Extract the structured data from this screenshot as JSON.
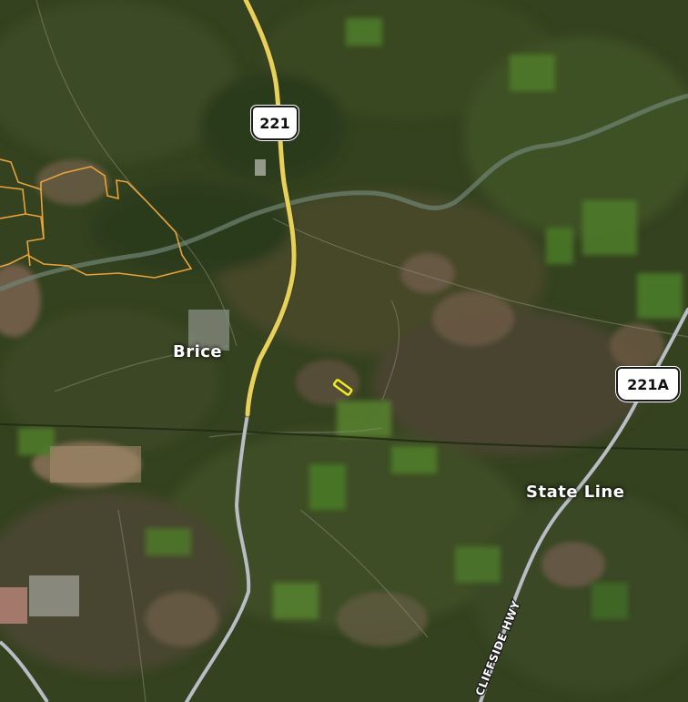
{
  "map": {
    "type": "satellite",
    "colors": {
      "highway_primary": "#e7d15a",
      "highway_secondary": "#b8bcc4",
      "parcel_outline": "#e8a33a",
      "highlight_marker": "#f2ef1e",
      "label_text": "#ffffff",
      "state_boundary": "#1e2a14"
    },
    "places": [
      {
        "id": "brice",
        "label": "Brice"
      },
      {
        "id": "state-line",
        "label": "State Line"
      }
    ],
    "shields": [
      {
        "id": "us-221",
        "label": "221"
      },
      {
        "id": "us-221a",
        "label": "221A"
      }
    ],
    "road_labels": [
      {
        "id": "cliffside-hwy",
        "label": "CLIFFSIDE HWY"
      }
    ],
    "icons": [
      "us-highway-shield-icon",
      "parcel-outline",
      "property-marker"
    ]
  }
}
